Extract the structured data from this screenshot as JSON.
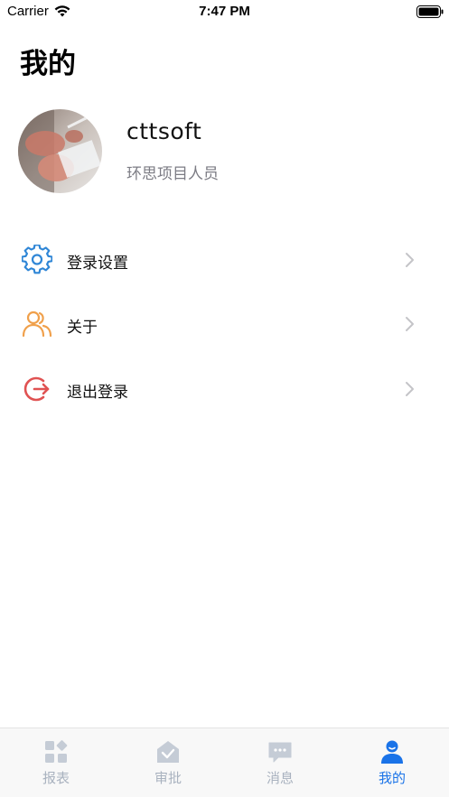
{
  "status_bar": {
    "carrier": "Carrier",
    "time": "7:47 PM",
    "wifi_icon": "wifi-icon",
    "battery_icon": "battery-icon"
  },
  "header": {
    "title": "我的"
  },
  "profile": {
    "username": "cttsoft",
    "role": "环思项目人员"
  },
  "menu": {
    "items": [
      {
        "label": "登录设置",
        "icon": "gear-icon",
        "color": "#2f86d6"
      },
      {
        "label": "关于",
        "icon": "users-icon",
        "color": "#f0a04b"
      },
      {
        "label": "退出登录",
        "icon": "logout-icon",
        "color": "#e05252"
      }
    ]
  },
  "tab_bar": {
    "active_color": "#1a73e8",
    "inactive_color": "#a9b2bf",
    "tabs": [
      {
        "label": "报表",
        "icon": "grid-icon",
        "active": false
      },
      {
        "label": "审批",
        "icon": "approval-icon",
        "active": false
      },
      {
        "label": "消息",
        "icon": "message-icon",
        "active": false
      },
      {
        "label": "我的",
        "icon": "person-icon",
        "active": true
      }
    ]
  }
}
